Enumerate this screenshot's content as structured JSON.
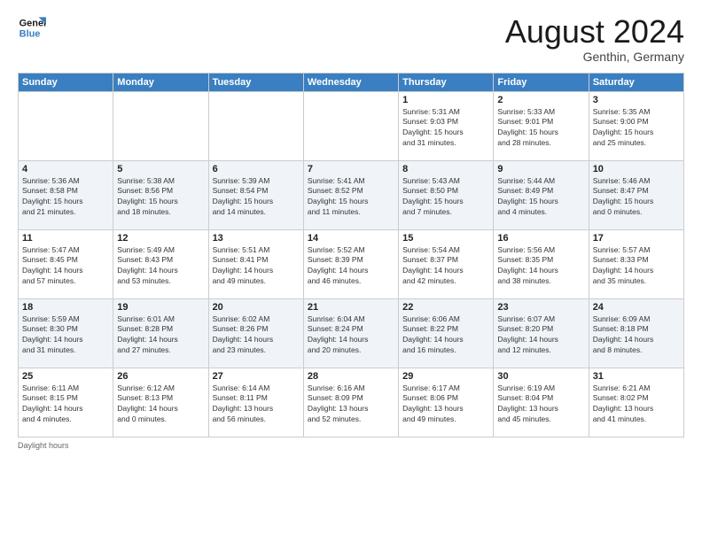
{
  "header": {
    "logo_general": "General",
    "logo_blue": "Blue",
    "month_title": "August 2024",
    "subtitle": "Genthin, Germany"
  },
  "days_of_week": [
    "Sunday",
    "Monday",
    "Tuesday",
    "Wednesday",
    "Thursday",
    "Friday",
    "Saturday"
  ],
  "weeks": [
    [
      {
        "day": "",
        "info": ""
      },
      {
        "day": "",
        "info": ""
      },
      {
        "day": "",
        "info": ""
      },
      {
        "day": "",
        "info": ""
      },
      {
        "day": "1",
        "info": "Sunrise: 5:31 AM\nSunset: 9:03 PM\nDaylight: 15 hours\nand 31 minutes."
      },
      {
        "day": "2",
        "info": "Sunrise: 5:33 AM\nSunset: 9:01 PM\nDaylight: 15 hours\nand 28 minutes."
      },
      {
        "day": "3",
        "info": "Sunrise: 5:35 AM\nSunset: 9:00 PM\nDaylight: 15 hours\nand 25 minutes."
      }
    ],
    [
      {
        "day": "4",
        "info": "Sunrise: 5:36 AM\nSunset: 8:58 PM\nDaylight: 15 hours\nand 21 minutes."
      },
      {
        "day": "5",
        "info": "Sunrise: 5:38 AM\nSunset: 8:56 PM\nDaylight: 15 hours\nand 18 minutes."
      },
      {
        "day": "6",
        "info": "Sunrise: 5:39 AM\nSunset: 8:54 PM\nDaylight: 15 hours\nand 14 minutes."
      },
      {
        "day": "7",
        "info": "Sunrise: 5:41 AM\nSunset: 8:52 PM\nDaylight: 15 hours\nand 11 minutes."
      },
      {
        "day": "8",
        "info": "Sunrise: 5:43 AM\nSunset: 8:50 PM\nDaylight: 15 hours\nand 7 minutes."
      },
      {
        "day": "9",
        "info": "Sunrise: 5:44 AM\nSunset: 8:49 PM\nDaylight: 15 hours\nand 4 minutes."
      },
      {
        "day": "10",
        "info": "Sunrise: 5:46 AM\nSunset: 8:47 PM\nDaylight: 15 hours\nand 0 minutes."
      }
    ],
    [
      {
        "day": "11",
        "info": "Sunrise: 5:47 AM\nSunset: 8:45 PM\nDaylight: 14 hours\nand 57 minutes."
      },
      {
        "day": "12",
        "info": "Sunrise: 5:49 AM\nSunset: 8:43 PM\nDaylight: 14 hours\nand 53 minutes."
      },
      {
        "day": "13",
        "info": "Sunrise: 5:51 AM\nSunset: 8:41 PM\nDaylight: 14 hours\nand 49 minutes."
      },
      {
        "day": "14",
        "info": "Sunrise: 5:52 AM\nSunset: 8:39 PM\nDaylight: 14 hours\nand 46 minutes."
      },
      {
        "day": "15",
        "info": "Sunrise: 5:54 AM\nSunset: 8:37 PM\nDaylight: 14 hours\nand 42 minutes."
      },
      {
        "day": "16",
        "info": "Sunrise: 5:56 AM\nSunset: 8:35 PM\nDaylight: 14 hours\nand 38 minutes."
      },
      {
        "day": "17",
        "info": "Sunrise: 5:57 AM\nSunset: 8:33 PM\nDaylight: 14 hours\nand 35 minutes."
      }
    ],
    [
      {
        "day": "18",
        "info": "Sunrise: 5:59 AM\nSunset: 8:30 PM\nDaylight: 14 hours\nand 31 minutes."
      },
      {
        "day": "19",
        "info": "Sunrise: 6:01 AM\nSunset: 8:28 PM\nDaylight: 14 hours\nand 27 minutes."
      },
      {
        "day": "20",
        "info": "Sunrise: 6:02 AM\nSunset: 8:26 PM\nDaylight: 14 hours\nand 23 minutes."
      },
      {
        "day": "21",
        "info": "Sunrise: 6:04 AM\nSunset: 8:24 PM\nDaylight: 14 hours\nand 20 minutes."
      },
      {
        "day": "22",
        "info": "Sunrise: 6:06 AM\nSunset: 8:22 PM\nDaylight: 14 hours\nand 16 minutes."
      },
      {
        "day": "23",
        "info": "Sunrise: 6:07 AM\nSunset: 8:20 PM\nDaylight: 14 hours\nand 12 minutes."
      },
      {
        "day": "24",
        "info": "Sunrise: 6:09 AM\nSunset: 8:18 PM\nDaylight: 14 hours\nand 8 minutes."
      }
    ],
    [
      {
        "day": "25",
        "info": "Sunrise: 6:11 AM\nSunset: 8:15 PM\nDaylight: 14 hours\nand 4 minutes."
      },
      {
        "day": "26",
        "info": "Sunrise: 6:12 AM\nSunset: 8:13 PM\nDaylight: 14 hours\nand 0 minutes."
      },
      {
        "day": "27",
        "info": "Sunrise: 6:14 AM\nSunset: 8:11 PM\nDaylight: 13 hours\nand 56 minutes."
      },
      {
        "day": "28",
        "info": "Sunrise: 6:16 AM\nSunset: 8:09 PM\nDaylight: 13 hours\nand 52 minutes."
      },
      {
        "day": "29",
        "info": "Sunrise: 6:17 AM\nSunset: 8:06 PM\nDaylight: 13 hours\nand 49 minutes."
      },
      {
        "day": "30",
        "info": "Sunrise: 6:19 AM\nSunset: 8:04 PM\nDaylight: 13 hours\nand 45 minutes."
      },
      {
        "day": "31",
        "info": "Sunrise: 6:21 AM\nSunset: 8:02 PM\nDaylight: 13 hours\nand 41 minutes."
      }
    ]
  ],
  "footer": {
    "daylight_label": "Daylight hours"
  }
}
